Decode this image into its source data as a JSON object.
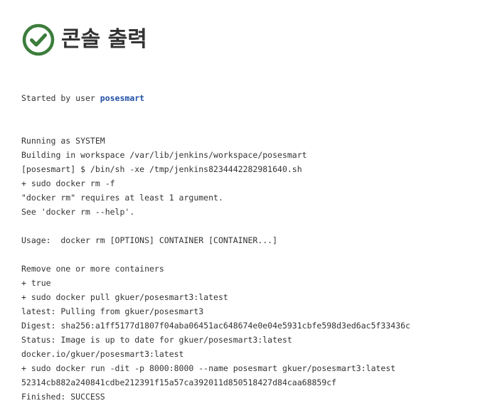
{
  "header": {
    "status_icon": "success-check-circle-icon",
    "title": "콘솔 출력",
    "success_color": "#3b7d3b"
  },
  "console": {
    "started_prefix": "Started by user ",
    "user_link": "posesmart",
    "lines": [
      "Running as SYSTEM",
      "Building in workspace /var/lib/jenkins/workspace/posesmart",
      "[posesmart] $ /bin/sh -xe /tmp/jenkins8234442282981640.sh",
      "+ sudo docker rm -f",
      "\"docker rm\" requires at least 1 argument.",
      "See 'docker rm --help'.",
      "",
      "Usage:  docker rm [OPTIONS] CONTAINER [CONTAINER...]",
      "",
      "Remove one or more containers",
      "+ true",
      "+ sudo docker pull gkuer/posesmart3:latest",
      "latest: Pulling from gkuer/posesmart3",
      "Digest: sha256:a1ff5177d1807f04aba06451ac648674e0e04e5931cbfe598d3ed6ac5f33436c",
      "Status: Image is up to date for gkuer/posesmart3:latest",
      "docker.io/gkuer/posesmart3:latest",
      "+ sudo docker run -dit -p 8000:8000 --name posesmart gkuer/posesmart3:latest",
      "52314cb882a240841cdbe212391f15a57ca392011d850518427d84caa68859cf",
      "Finished: SUCCESS"
    ]
  }
}
